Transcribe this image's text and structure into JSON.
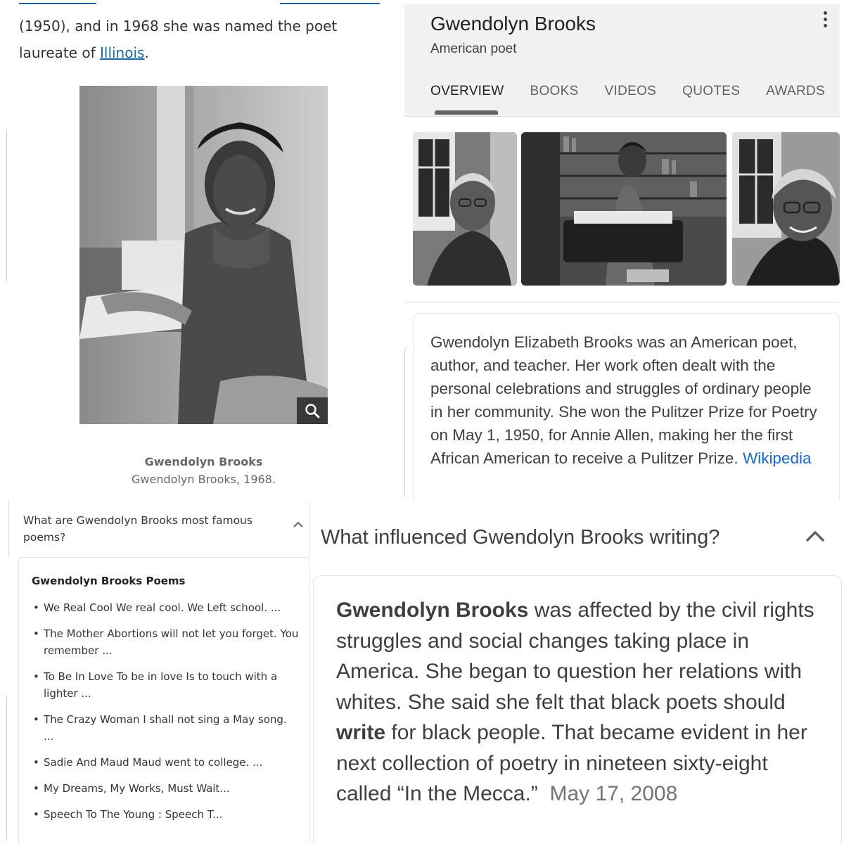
{
  "article": {
    "paragraph_part1": "(1950), and in 1968 she was named the poet laureate of ",
    "link_illinois": "Illinois",
    "paragraph_end": ".",
    "photo_caption_title": "Gwendolyn Brooks",
    "photo_caption_sub": "Gwendolyn Brooks, 1968.",
    "zoom_icon": "search-icon"
  },
  "knowledge_panel": {
    "title": "Gwendolyn Brooks",
    "subtitle": "American poet",
    "more_icon": "vertical-dots-icon",
    "tabs": [
      {
        "label": "OVERVIEW",
        "active": true
      },
      {
        "label": "BOOKS"
      },
      {
        "label": "VIDEOS"
      },
      {
        "label": "QUOTES"
      },
      {
        "label": "AWARDS"
      }
    ],
    "description": "Gwendolyn Elizabeth Brooks was an American poet, author, and teacher. Her work often dealt with the personal celebrations and struggles of ordinary people in her community. She won the Pulitzer Prize for Poetry on May 1, 1950, for Annie Allen, making her the first African American to receive a Pulitzer Prize.",
    "source_link": "Wikipedia"
  },
  "faq": {
    "question": "What are Gwendolyn Brooks most famous poems?",
    "heading": "Gwendolyn Brooks Poems",
    "items": [
      "We Real Cool We real cool. We Left school. ...",
      "The Mother Abortions will not let you forget. You remember ...",
      "To Be In Love To be in love Is to touch with a lighter ...",
      "The Crazy Woman I shall not sing a May song. ...",
      "Sadie And Maud Maud went to college. ...",
      "My Dreams, My Works, Must Wait...",
      "Speech To The Young : Speech T..."
    ]
  },
  "influence": {
    "question": "What influenced Gwendolyn Brooks writing?",
    "answer_bold_1": "Gwendolyn Brooks",
    "answer_part_1": " was affected by the civil rights struggles and social changes taking place in America. She began to question her relations with whites. She said she felt that black poets should ",
    "answer_bold_2": "write",
    "answer_part_2": " for black people. That became evident in her next collection of poetry in nineteen sixty-eight called “In the Mecca.”",
    "date": "May 17, 2008"
  },
  "colors": {
    "link": "#1a6aa8",
    "wiki_link": "#1967d2",
    "header_bg": "#f1f1f1"
  }
}
